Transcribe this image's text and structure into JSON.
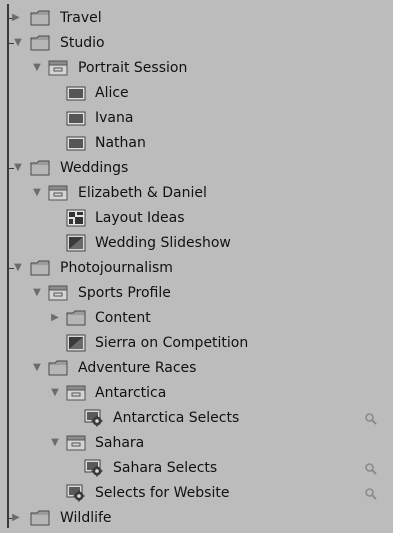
{
  "tree": {
    "items": [
      {
        "label": "Travel"
      },
      {
        "label": "Studio"
      },
      {
        "label": "Portrait Session"
      },
      {
        "label": "Alice"
      },
      {
        "label": "Ivana"
      },
      {
        "label": "Nathan"
      },
      {
        "label": "Weddings"
      },
      {
        "label": "Elizabeth & Daniel"
      },
      {
        "label": "Layout Ideas"
      },
      {
        "label": "Wedding Slideshow"
      },
      {
        "label": "Photojournalism"
      },
      {
        "label": "Sports Profile"
      },
      {
        "label": "Content"
      },
      {
        "label": "Sierra on Competition"
      },
      {
        "label": "Adventure Races"
      },
      {
        "label": "Antarctica"
      },
      {
        "label": "Antarctica Selects"
      },
      {
        "label": "Sahara"
      },
      {
        "label": "Sahara Selects"
      },
      {
        "label": "Selects for Website"
      },
      {
        "label": "Wildlife"
      }
    ]
  },
  "icons": {
    "folder": "folder-icon",
    "project": "project-icon",
    "album": "album-icon",
    "smart_album": "smart-album-icon",
    "layout": "light-table-icon",
    "slideshow": "slideshow-icon",
    "search": "magnifier-icon"
  }
}
